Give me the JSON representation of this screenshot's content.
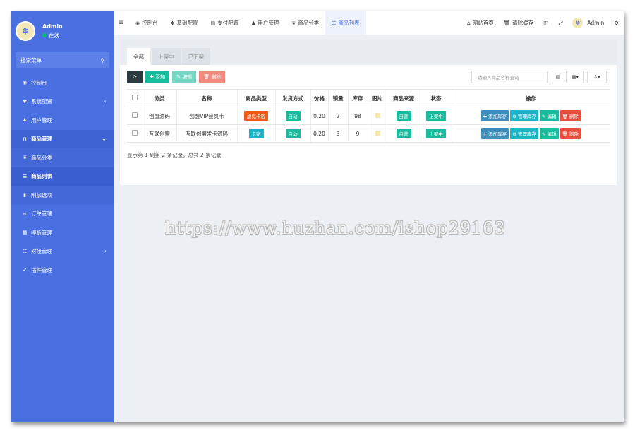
{
  "sidebar": {
    "user_name": "Admin",
    "user_status": "在线",
    "avatar_text": "华",
    "search_label": "搜索菜单",
    "items": [
      {
        "label": "控制台",
        "icon": "dashboard-icon",
        "glyph": "◉"
      },
      {
        "label": "系统配置",
        "icon": "gear-icon",
        "glyph": "✱",
        "arrow": "‹"
      },
      {
        "label": "用户管理",
        "icon": "user-icon",
        "glyph": "♟"
      },
      {
        "label": "商品管理",
        "icon": "cart-icon",
        "glyph": "⊓",
        "arrow": "⌄"
      },
      {
        "label": "商品分类",
        "icon": "leaf-icon",
        "glyph": "❦"
      },
      {
        "label": "商品列表",
        "icon": "list-icon",
        "glyph": "☰"
      },
      {
        "label": "附加选项",
        "icon": "bookmark-icon",
        "glyph": "▮"
      },
      {
        "label": "订单管理",
        "icon": "list-icon",
        "glyph": "≡"
      },
      {
        "label": "模板管理",
        "icon": "template-icon",
        "glyph": "▦"
      },
      {
        "label": "对接管理",
        "icon": "sliders-icon",
        "glyph": "☷",
        "arrow": "‹"
      },
      {
        "label": "插件管理",
        "icon": "rocket-icon",
        "glyph": "➶"
      }
    ]
  },
  "topbar": {
    "tabs": [
      {
        "label": "控制台",
        "glyph": "◉"
      },
      {
        "label": "基础配置",
        "glyph": "✱"
      },
      {
        "label": "支付配置",
        "glyph": "▤"
      },
      {
        "label": "用户管理",
        "glyph": "♟"
      },
      {
        "label": "商品分类",
        "glyph": "❦"
      },
      {
        "label": "商品列表",
        "glyph": "☰"
      }
    ],
    "home_label": "网站首页",
    "clear_cache_label": "清除缓存",
    "admin_label": "Admin"
  },
  "panel": {
    "tabs": [
      "全部",
      "上架中",
      "已下架"
    ],
    "add_label": "添加",
    "edit_label": "编辑",
    "delete_label": "删除",
    "search_placeholder": "请输入商品名称查询"
  },
  "table": {
    "headers": [
      "分类",
      "名称",
      "商品类型",
      "发货方式",
      "价格",
      "销量",
      "库存",
      "图片",
      "商品来源",
      "状态",
      "操作"
    ],
    "rows": [
      {
        "category": "创盟源码",
        "name": "创盟VIP会员卡",
        "type": "虚拟卡密",
        "delivery": "自动",
        "price": "0.20",
        "sales": "2",
        "stock": "98",
        "source": "自营",
        "status": "上架中"
      },
      {
        "category": "互联创盟",
        "name": "互联创盟发卡源码",
        "type": "卡密",
        "delivery": "自动",
        "price": "0.20",
        "sales": "3",
        "stock": "9",
        "source": "自营",
        "status": "上架中"
      }
    ],
    "op_labels": {
      "add_stock": "添加库存",
      "manage_stock": "管理库存",
      "edit": "编辑",
      "delete": "删除"
    },
    "footer": "显示第 1 到第 2 条记录，总共 2 条记录"
  },
  "watermark": "https://www.huzhan.com/ishop29163",
  "colors": {
    "sidebar": "#4a6fe0",
    "accent": "#18bc9c",
    "danger": "#e74c3c",
    "info": "#3c8dbc"
  }
}
